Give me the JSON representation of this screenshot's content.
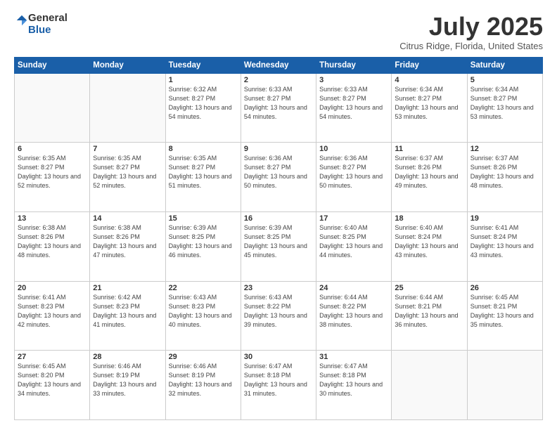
{
  "logo": {
    "general": "General",
    "blue": "Blue"
  },
  "title": "July 2025",
  "location": "Citrus Ridge, Florida, United States",
  "weekdays": [
    "Sunday",
    "Monday",
    "Tuesday",
    "Wednesday",
    "Thursday",
    "Friday",
    "Saturday"
  ],
  "weeks": [
    [
      {
        "day": "",
        "info": ""
      },
      {
        "day": "",
        "info": ""
      },
      {
        "day": "1",
        "info": "Sunrise: 6:32 AM\nSunset: 8:27 PM\nDaylight: 13 hours and 54 minutes."
      },
      {
        "day": "2",
        "info": "Sunrise: 6:33 AM\nSunset: 8:27 PM\nDaylight: 13 hours and 54 minutes."
      },
      {
        "day": "3",
        "info": "Sunrise: 6:33 AM\nSunset: 8:27 PM\nDaylight: 13 hours and 54 minutes."
      },
      {
        "day": "4",
        "info": "Sunrise: 6:34 AM\nSunset: 8:27 PM\nDaylight: 13 hours and 53 minutes."
      },
      {
        "day": "5",
        "info": "Sunrise: 6:34 AM\nSunset: 8:27 PM\nDaylight: 13 hours and 53 minutes."
      }
    ],
    [
      {
        "day": "6",
        "info": "Sunrise: 6:35 AM\nSunset: 8:27 PM\nDaylight: 13 hours and 52 minutes."
      },
      {
        "day": "7",
        "info": "Sunrise: 6:35 AM\nSunset: 8:27 PM\nDaylight: 13 hours and 52 minutes."
      },
      {
        "day": "8",
        "info": "Sunrise: 6:35 AM\nSunset: 8:27 PM\nDaylight: 13 hours and 51 minutes."
      },
      {
        "day": "9",
        "info": "Sunrise: 6:36 AM\nSunset: 8:27 PM\nDaylight: 13 hours and 50 minutes."
      },
      {
        "day": "10",
        "info": "Sunrise: 6:36 AM\nSunset: 8:27 PM\nDaylight: 13 hours and 50 minutes."
      },
      {
        "day": "11",
        "info": "Sunrise: 6:37 AM\nSunset: 8:26 PM\nDaylight: 13 hours and 49 minutes."
      },
      {
        "day": "12",
        "info": "Sunrise: 6:37 AM\nSunset: 8:26 PM\nDaylight: 13 hours and 48 minutes."
      }
    ],
    [
      {
        "day": "13",
        "info": "Sunrise: 6:38 AM\nSunset: 8:26 PM\nDaylight: 13 hours and 48 minutes."
      },
      {
        "day": "14",
        "info": "Sunrise: 6:38 AM\nSunset: 8:26 PM\nDaylight: 13 hours and 47 minutes."
      },
      {
        "day": "15",
        "info": "Sunrise: 6:39 AM\nSunset: 8:25 PM\nDaylight: 13 hours and 46 minutes."
      },
      {
        "day": "16",
        "info": "Sunrise: 6:39 AM\nSunset: 8:25 PM\nDaylight: 13 hours and 45 minutes."
      },
      {
        "day": "17",
        "info": "Sunrise: 6:40 AM\nSunset: 8:25 PM\nDaylight: 13 hours and 44 minutes."
      },
      {
        "day": "18",
        "info": "Sunrise: 6:40 AM\nSunset: 8:24 PM\nDaylight: 13 hours and 43 minutes."
      },
      {
        "day": "19",
        "info": "Sunrise: 6:41 AM\nSunset: 8:24 PM\nDaylight: 13 hours and 43 minutes."
      }
    ],
    [
      {
        "day": "20",
        "info": "Sunrise: 6:41 AM\nSunset: 8:23 PM\nDaylight: 13 hours and 42 minutes."
      },
      {
        "day": "21",
        "info": "Sunrise: 6:42 AM\nSunset: 8:23 PM\nDaylight: 13 hours and 41 minutes."
      },
      {
        "day": "22",
        "info": "Sunrise: 6:43 AM\nSunset: 8:23 PM\nDaylight: 13 hours and 40 minutes."
      },
      {
        "day": "23",
        "info": "Sunrise: 6:43 AM\nSunset: 8:22 PM\nDaylight: 13 hours and 39 minutes."
      },
      {
        "day": "24",
        "info": "Sunrise: 6:44 AM\nSunset: 8:22 PM\nDaylight: 13 hours and 38 minutes."
      },
      {
        "day": "25",
        "info": "Sunrise: 6:44 AM\nSunset: 8:21 PM\nDaylight: 13 hours and 36 minutes."
      },
      {
        "day": "26",
        "info": "Sunrise: 6:45 AM\nSunset: 8:21 PM\nDaylight: 13 hours and 35 minutes."
      }
    ],
    [
      {
        "day": "27",
        "info": "Sunrise: 6:45 AM\nSunset: 8:20 PM\nDaylight: 13 hours and 34 minutes."
      },
      {
        "day": "28",
        "info": "Sunrise: 6:46 AM\nSunset: 8:19 PM\nDaylight: 13 hours and 33 minutes."
      },
      {
        "day": "29",
        "info": "Sunrise: 6:46 AM\nSunset: 8:19 PM\nDaylight: 13 hours and 32 minutes."
      },
      {
        "day": "30",
        "info": "Sunrise: 6:47 AM\nSunset: 8:18 PM\nDaylight: 13 hours and 31 minutes."
      },
      {
        "day": "31",
        "info": "Sunrise: 6:47 AM\nSunset: 8:18 PM\nDaylight: 13 hours and 30 minutes."
      },
      {
        "day": "",
        "info": ""
      },
      {
        "day": "",
        "info": ""
      }
    ]
  ]
}
